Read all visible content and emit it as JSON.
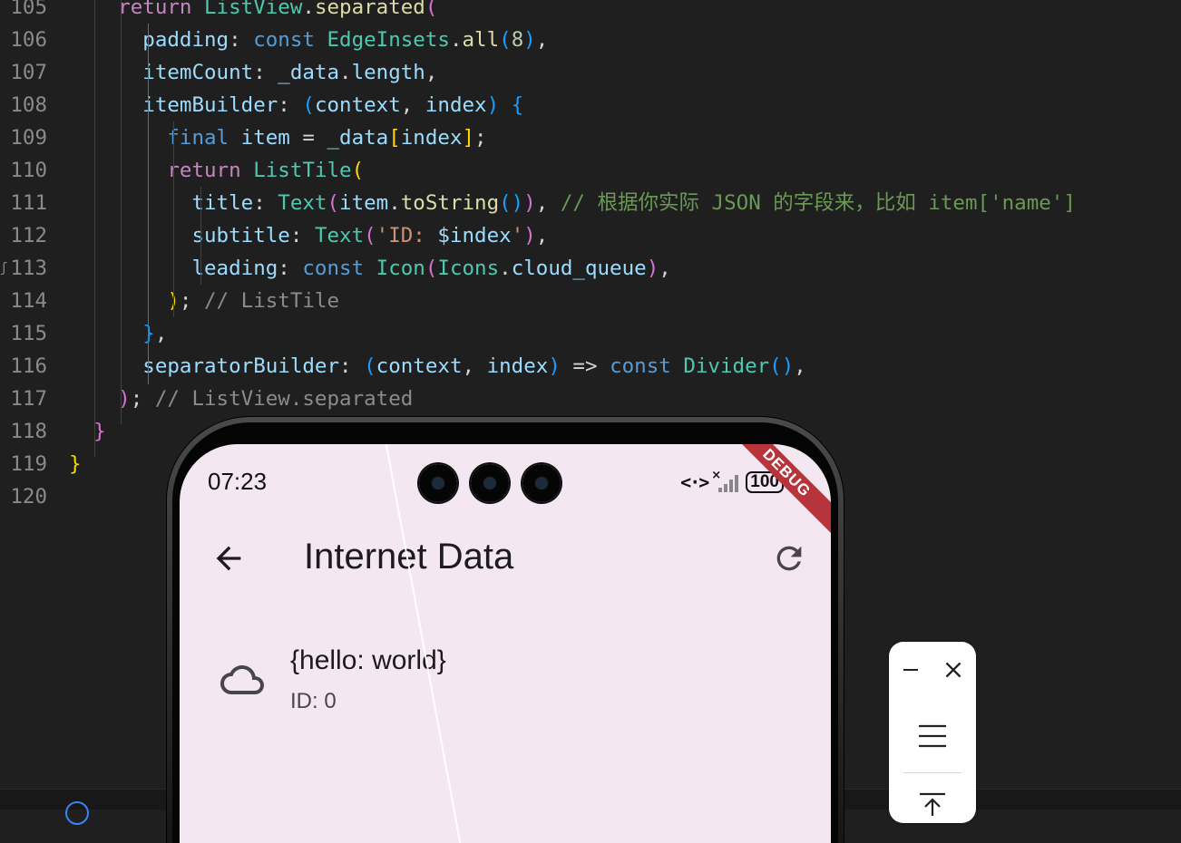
{
  "editor": {
    "lines": [
      {
        "num": "105",
        "parts": [
          {
            "t": "    "
          },
          {
            "t": "return",
            "c": "kw"
          },
          {
            "t": " "
          },
          {
            "t": "ListView",
            "c": "cls"
          },
          {
            "t": "."
          },
          {
            "t": "separated",
            "c": "fn"
          },
          {
            "t": "(",
            "c": "b2"
          }
        ]
      },
      {
        "num": "106",
        "parts": [
          {
            "t": "      "
          },
          {
            "t": "padding",
            "c": "prop"
          },
          {
            "t": ": "
          },
          {
            "t": "const",
            "c": "st"
          },
          {
            "t": " "
          },
          {
            "t": "EdgeInsets",
            "c": "cls"
          },
          {
            "t": "."
          },
          {
            "t": "all",
            "c": "fn"
          },
          {
            "t": "(",
            "c": "b3"
          },
          {
            "t": "8",
            "c": "num"
          },
          {
            "t": ")",
            "c": "b3"
          },
          {
            "t": ","
          }
        ]
      },
      {
        "num": "107",
        "parts": [
          {
            "t": "      "
          },
          {
            "t": "itemCount",
            "c": "prop"
          },
          {
            "t": ": "
          },
          {
            "t": "_data",
            "c": "prop"
          },
          {
            "t": "."
          },
          {
            "t": "length",
            "c": "prop"
          },
          {
            "t": ","
          }
        ]
      },
      {
        "num": "108",
        "parts": [
          {
            "t": "      "
          },
          {
            "t": "itemBuilder",
            "c": "prop"
          },
          {
            "t": ": "
          },
          {
            "t": "(",
            "c": "b3"
          },
          {
            "t": "context",
            "c": "prop"
          },
          {
            "t": ", "
          },
          {
            "t": "index",
            "c": "prop"
          },
          {
            "t": ")",
            "c": "b3"
          },
          {
            "t": " "
          },
          {
            "t": "{",
            "c": "b3"
          }
        ]
      },
      {
        "num": "109",
        "parts": [
          {
            "t": "        "
          },
          {
            "t": "final",
            "c": "st"
          },
          {
            "t": " "
          },
          {
            "t": "item",
            "c": "prop"
          },
          {
            "t": " = "
          },
          {
            "t": "_data",
            "c": "prop"
          },
          {
            "t": "[",
            "c": "b1"
          },
          {
            "t": "index",
            "c": "prop"
          },
          {
            "t": "]",
            "c": "b1"
          },
          {
            "t": ";"
          }
        ]
      },
      {
        "num": "110",
        "parts": [
          {
            "t": "        "
          },
          {
            "t": "return",
            "c": "kw"
          },
          {
            "t": " "
          },
          {
            "t": "ListTile",
            "c": "cls"
          },
          {
            "t": "(",
            "c": "b1"
          }
        ]
      },
      {
        "num": "111",
        "parts": [
          {
            "t": "          "
          },
          {
            "t": "title",
            "c": "prop"
          },
          {
            "t": ": "
          },
          {
            "t": "Text",
            "c": "cls"
          },
          {
            "t": "(",
            "c": "b2"
          },
          {
            "t": "item",
            "c": "prop"
          },
          {
            "t": "."
          },
          {
            "t": "toString",
            "c": "fn"
          },
          {
            "t": "()",
            "c": "b3"
          },
          {
            "t": ")",
            "c": "b2"
          },
          {
            "t": ", "
          },
          {
            "t": "// 根据你实际 JSON 的字段来，比如 item['name']",
            "c": "cmt"
          }
        ]
      },
      {
        "num": "112",
        "parts": [
          {
            "t": "          "
          },
          {
            "t": "subtitle",
            "c": "prop"
          },
          {
            "t": ": "
          },
          {
            "t": "Text",
            "c": "cls"
          },
          {
            "t": "(",
            "c": "b2"
          },
          {
            "t": "'ID: ",
            "c": "str"
          },
          {
            "t": "$index",
            "c": "prop"
          },
          {
            "t": "'",
            "c": "str"
          },
          {
            "t": ")",
            "c": "b2"
          },
          {
            "t": ","
          }
        ]
      },
      {
        "num": "113",
        "parts": [
          {
            "t": "          "
          },
          {
            "t": "leading",
            "c": "prop"
          },
          {
            "t": ": "
          },
          {
            "t": "const",
            "c": "st"
          },
          {
            "t": " "
          },
          {
            "t": "Icon",
            "c": "cls"
          },
          {
            "t": "(",
            "c": "b2"
          },
          {
            "t": "Icons",
            "c": "cls"
          },
          {
            "t": "."
          },
          {
            "t": "cloud_queue",
            "c": "prop"
          },
          {
            "t": ")",
            "c": "b2"
          },
          {
            "t": ","
          }
        ]
      },
      {
        "num": "114",
        "parts": [
          {
            "t": "        "
          },
          {
            "t": ")",
            "c": "b1"
          },
          {
            "t": "; "
          },
          {
            "t": "// ListTile",
            "c": "hint"
          }
        ]
      },
      {
        "num": "115",
        "parts": [
          {
            "t": "      "
          },
          {
            "t": "}",
            "c": "b3"
          },
          {
            "t": ","
          }
        ]
      },
      {
        "num": "116",
        "parts": [
          {
            "t": "      "
          },
          {
            "t": "separatorBuilder",
            "c": "prop"
          },
          {
            "t": ": "
          },
          {
            "t": "(",
            "c": "b3"
          },
          {
            "t": "context",
            "c": "prop"
          },
          {
            "t": ", "
          },
          {
            "t": "index",
            "c": "prop"
          },
          {
            "t": ")",
            "c": "b3"
          },
          {
            "t": " => "
          },
          {
            "t": "const",
            "c": "st"
          },
          {
            "t": " "
          },
          {
            "t": "Divider",
            "c": "cls"
          },
          {
            "t": "(",
            "c": "b3"
          },
          {
            "t": ")",
            "c": "b3"
          },
          {
            "t": ","
          }
        ]
      },
      {
        "num": "117",
        "parts": [
          {
            "t": "    "
          },
          {
            "t": ")",
            "c": "b2"
          },
          {
            "t": "; "
          },
          {
            "t": "// ListView.separated",
            "c": "hint"
          }
        ]
      },
      {
        "num": "118",
        "parts": [
          {
            "t": "  "
          },
          {
            "t": "}",
            "c": "b2"
          }
        ]
      },
      {
        "num": "119",
        "parts": [
          {
            "t": "}",
            "c": "b1"
          }
        ]
      },
      {
        "num": "120",
        "parts": []
      }
    ]
  },
  "phone": {
    "status_time": "07:23",
    "battery": "100",
    "debug_banner": "DEBUG",
    "app_bar": {
      "title": "Internet Data",
      "back_icon": "arrow-back-icon",
      "refresh_icon": "refresh-icon"
    },
    "list": [
      {
        "icon": "cloud-queue-icon",
        "title": "{hello: world}",
        "subtitle": "ID: 0"
      }
    ]
  },
  "float_toolbar": {
    "icons": [
      "minimize-icon",
      "close-icon",
      "menu-icon",
      "upload-icon"
    ]
  }
}
